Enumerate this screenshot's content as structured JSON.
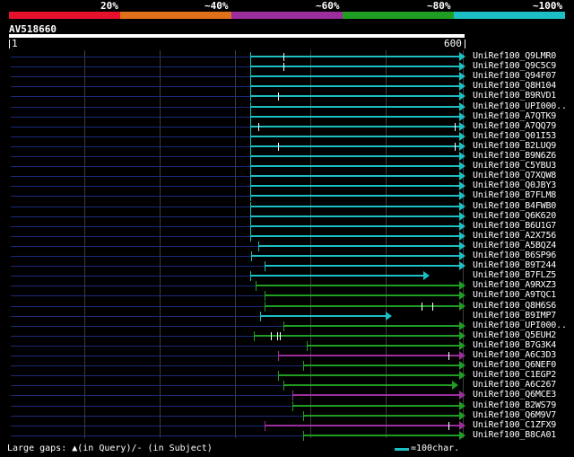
{
  "legend": {
    "labels": [
      "20%",
      "~40%",
      "~60%",
      "~80%",
      "~100%"
    ],
    "colors": [
      "#e8112d",
      "#e0701a",
      "#9b2e9c",
      "#1f9e23",
      "#1cbfc3"
    ]
  },
  "query": {
    "name": "AV518660",
    "start": "1",
    "end": "600"
  },
  "rows": [
    {
      "label": "UniRef100_Q9LMR0",
      "color": "cyan",
      "start": 279,
      "end": 512,
      "marks": [
        316
      ]
    },
    {
      "label": "UniRef100_Q9C5C9",
      "color": "cyan",
      "start": 279,
      "end": 512,
      "marks": [
        316
      ]
    },
    {
      "label": "UniRef100_Q94F07",
      "color": "cyan",
      "start": 279,
      "end": 512,
      "marks": []
    },
    {
      "label": "UniRef100_Q8H104",
      "color": "cyan",
      "start": 279,
      "end": 512,
      "marks": []
    },
    {
      "label": "UniRef100_B9RVD1",
      "color": "cyan",
      "start": 279,
      "end": 512,
      "marks": [
        310
      ]
    },
    {
      "label": "UniRef100_UPI000..",
      "color": "cyan",
      "start": 279,
      "end": 512,
      "marks": []
    },
    {
      "label": "UniRef100_A7QTK9",
      "color": "cyan",
      "start": 279,
      "end": 512,
      "marks": []
    },
    {
      "label": "UniRef100_A7QQ79",
      "color": "cyan",
      "start": 279,
      "end": 512,
      "marks": [
        288,
        507
      ]
    },
    {
      "label": "UniRef100_Q01I53",
      "color": "cyan",
      "start": 279,
      "end": 512,
      "marks": []
    },
    {
      "label": "UniRef100_B2LUQ9",
      "color": "cyan",
      "start": 279,
      "end": 512,
      "marks": [
        310,
        507
      ]
    },
    {
      "label": "UniRef100_B9N6Z6",
      "color": "cyan",
      "start": 279,
      "end": 512,
      "marks": []
    },
    {
      "label": "UniRef100_C5YBU3",
      "color": "cyan",
      "start": 279,
      "end": 512,
      "marks": []
    },
    {
      "label": "UniRef100_Q7XQW8",
      "color": "cyan",
      "start": 279,
      "end": 512,
      "marks": []
    },
    {
      "label": "UniRef100_Q0JBY3",
      "color": "cyan",
      "start": 279,
      "end": 512,
      "marks": []
    },
    {
      "label": "UniRef100_B7FLM8",
      "color": "cyan",
      "start": 279,
      "end": 512,
      "marks": []
    },
    {
      "label": "UniRef100_B4FWB0",
      "color": "cyan",
      "start": 279,
      "end": 512,
      "marks": []
    },
    {
      "label": "UniRef100_Q6K620",
      "color": "cyan",
      "start": 279,
      "end": 512,
      "marks": []
    },
    {
      "label": "UniRef100_B6U1G7",
      "color": "cyan",
      "start": 279,
      "end": 512,
      "marks": []
    },
    {
      "label": "UniRef100_A2X756",
      "color": "cyan",
      "start": 279,
      "end": 512,
      "marks": []
    },
    {
      "label": "UniRef100_A5BQZ4",
      "color": "cyan",
      "start": 288,
      "end": 512,
      "marks": []
    },
    {
      "label": "UniRef100_B6SP96",
      "color": "cyan",
      "start": 280,
      "end": 512,
      "marks": []
    },
    {
      "label": "UniRef100_B9T244",
      "color": "cyan",
      "start": 295,
      "end": 512,
      "marks": []
    },
    {
      "label": "UniRef100_B7FLZ5",
      "color": "cyan",
      "start": 279,
      "end": 472,
      "marks": []
    },
    {
      "label": "UniRef100_A9RXZ3",
      "color": "green",
      "start": 285,
      "end": 512,
      "marks": []
    },
    {
      "label": "UniRef100_A9TQC1",
      "color": "green",
      "start": 295,
      "end": 512,
      "marks": []
    },
    {
      "label": "UniRef100_Q8H6S6",
      "color": "green",
      "start": 295,
      "end": 512,
      "marks": [
        470,
        482
      ]
    },
    {
      "label": "UniRef100_B9IMP7",
      "color": "cyan",
      "start": 290,
      "end": 430,
      "marks": []
    },
    {
      "label": "UniRef100_UPI000..",
      "color": "green",
      "start": 316,
      "end": 512,
      "marks": []
    },
    {
      "label": "UniRef100_Q5EUH2",
      "color": "green",
      "start": 283,
      "end": 512,
      "marks": [
        302,
        309,
        312
      ]
    },
    {
      "label": "UniRef100_B7G3K4",
      "color": "green",
      "start": 342,
      "end": 512,
      "marks": []
    },
    {
      "label": "UniRef100_A6C3D3",
      "color": "purple",
      "start": 310,
      "end": 512,
      "marks": [
        500
      ]
    },
    {
      "label": "UniRef100_Q6NEF0",
      "color": "green",
      "start": 338,
      "end": 512,
      "marks": []
    },
    {
      "label": "UniRef100_C1EGP2",
      "color": "green",
      "start": 310,
      "end": 512,
      "marks": []
    },
    {
      "label": "UniRef100_A6C267",
      "color": "green",
      "start": 316,
      "end": 504,
      "marks": []
    },
    {
      "label": "UniRef100_Q6MCE3",
      "color": "purple",
      "start": 326,
      "end": 512,
      "marks": []
    },
    {
      "label": "UniRef100_B2WS79",
      "color": "green",
      "start": 326,
      "end": 512,
      "marks": []
    },
    {
      "label": "UniRef100_Q6M9V7",
      "color": "green",
      "start": 338,
      "end": 512,
      "marks": []
    },
    {
      "label": "UniRef100_C1ZFX9",
      "color": "purple",
      "start": 295,
      "end": 512,
      "marks": [
        500
      ]
    },
    {
      "label": "UniRef100_B8CA01",
      "color": "green",
      "start": 338,
      "end": 512,
      "marks": []
    }
  ],
  "footer": {
    "left": "Large gaps: ▲(in Query)/- (in Subject)",
    "right": "=100char.",
    "line_color": "#1cbfc3"
  }
}
